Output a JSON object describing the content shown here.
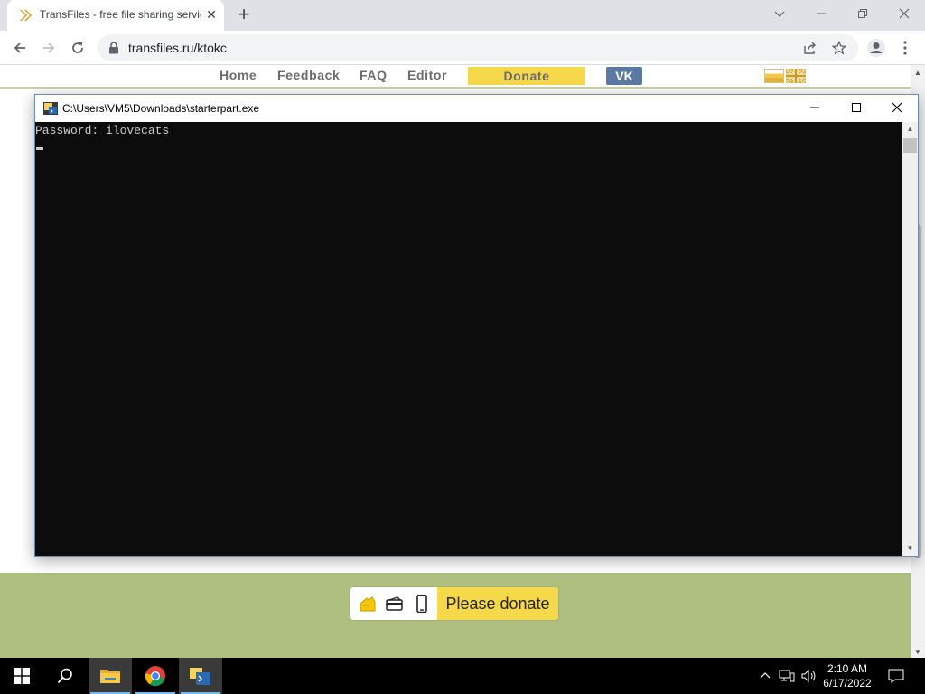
{
  "browser": {
    "tab_title": "TransFiles - free file sharing service",
    "url": "transfiles.ru/ktokc",
    "tab_close_glyph": "✕",
    "new_tab_glyph": "+",
    "icons": [
      "chevron-down-icon",
      "minimize-icon",
      "restore-icon",
      "close-icon",
      "back-icon",
      "forward-icon",
      "reload-icon",
      "lock-icon",
      "share-icon",
      "star-icon",
      "profile-icon",
      "menu-icon"
    ]
  },
  "site": {
    "nav": {
      "home": "Home",
      "feedback": "Feedback",
      "faq": "FAQ",
      "editor": "Editor",
      "donate": "Donate",
      "vk": "VK"
    },
    "donate_button": "Please donate",
    "colors": {
      "footer": "#aebf80",
      "donate": "#f6d94a",
      "vk": "#5b7aa3"
    }
  },
  "console": {
    "title": "C:\\Users\\VM5\\Downloads\\starterpart.exe",
    "lines": [
      "Password: ilovecats"
    ],
    "background": "#0c0c0c"
  },
  "taskbar": {
    "time": "2:10 AM",
    "date": "6/17/2022",
    "items": [
      "start-button",
      "search-button",
      "file-explorer",
      "chrome",
      "console-app"
    ]
  }
}
